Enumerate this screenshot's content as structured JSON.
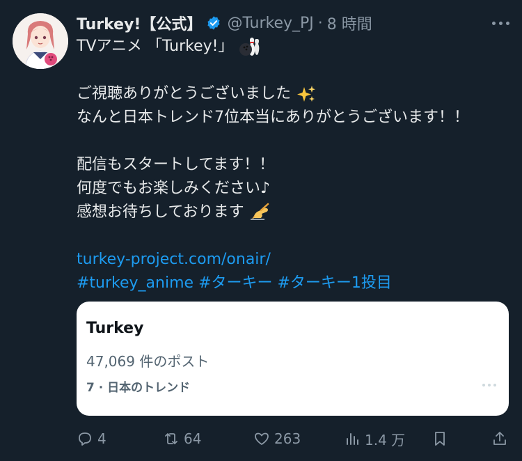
{
  "author": {
    "name": "Turkey!【公式】",
    "handle": "@Turkey_PJ",
    "separator": "·",
    "time": "8 時間"
  },
  "tweet": {
    "line1": "TVアニメ 「Turkey!」",
    "line3": "ご視聴ありがとうございました",
    "line4": "なんと日本トレンド7位本当にありがとうございます！！",
    "line6": "配信もスタートしてます！！",
    "line7": "何度でもお楽しみください♪",
    "line8": "感想お待ちしております",
    "link": "turkey-project.com/onair/",
    "hashtag1": "#turkey_anime",
    "hashtag2": "#ターキー",
    "hashtag3": "#ターキー1投目"
  },
  "card": {
    "title": "Turkey",
    "count": "47,069 件のポスト",
    "rank": "7 · 日本のトレンド"
  },
  "actions": {
    "replies": "4",
    "retweets": "64",
    "likes": "263",
    "views": "1.4 万"
  },
  "colors": {
    "background": "#15202b",
    "link": "#1d9bf0",
    "verified": "#1d9bf0",
    "muted": "#8b98a5"
  },
  "icons": [
    "verified-icon",
    "more-icon",
    "bowling-emoji",
    "sparkles-emoji",
    "writing-hand-emoji",
    "reply-icon",
    "retweet-icon",
    "like-icon",
    "views-icon",
    "bookmark-icon",
    "share-icon"
  ]
}
